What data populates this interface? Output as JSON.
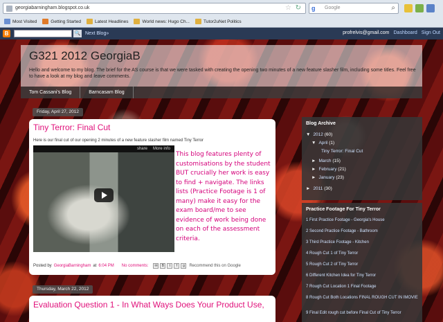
{
  "browser": {
    "url": "georgiabarningham.blogspot.co.uk",
    "search_placeholder": "Google",
    "bookmarks": [
      "Most Visited",
      "Getting Started",
      "Latest Headlines",
      "World news: Hugo Ch...",
      "Tutor2uNet Politics"
    ]
  },
  "navbar": {
    "next_blog": "Next Blog»",
    "email": "profrelvis@gmail.com",
    "dashboard": "Dashboard",
    "signout": "Sign Out"
  },
  "blog": {
    "title": "G321 2012 GeorgiaB",
    "description": "Hello and welcome to my blog. The brief for the AS course is that we were tasked with creating the opening two minutes of a new feature slasher film, including some titles. Feel free to have a look at my blog and leave comments.",
    "tabs": [
      "Tom Cassani's Blog",
      "Barncasam Blog"
    ]
  },
  "post1": {
    "date": "Friday, April 27, 2012",
    "title": "Tiny Terror: Final Cut",
    "intro": "Here is our final cut of our opening 2 minutes of a new feature slasher film named Tiny Terror",
    "video_share": "share",
    "video_info": "More info",
    "annotation": "This blog features plenty of customisations by the student BUT crucially her work is easy to find + navigate. The links lists (Practice Footage is 1 of many) make it easy for the exam board/me to see evidence of work being done on each of the assessment criteria.",
    "posted_by_prefix": "Posted by",
    "author": "GeorgiaBarningham",
    "at": "at",
    "time": "6:04 PM",
    "comments": "No comments:",
    "recommend": "Recommend this on Google"
  },
  "post2": {
    "date": "Thursday, March 22, 2012",
    "title": "Evaluation Question 1 - In What Ways Does Your Product Use,"
  },
  "archive": {
    "title": "Blog Archive",
    "y2012": "2012",
    "y2012_count": "(60)",
    "april": "April",
    "april_count": "(1)",
    "april_post": "Tiny Terror: Final Cut",
    "march": "March",
    "march_count": "(15)",
    "february": "February",
    "february_count": "(21)",
    "january": "January",
    "january_count": "(23)",
    "y2011": "2011",
    "y2011_count": "(30)"
  },
  "footage": {
    "title": "Practice Footage For Tiny Terror",
    "items": [
      "1 First Practice Footage - Georgia's House",
      "2 Second Practice Footage - Bathroom",
      "3 Third Practice Footage - Kitchen",
      "4 Rough Cut 1 of Tiny Terror",
      "5 Rough Cut 2 of Tiny Terror",
      "6 Different Kitchen Idea for Tiny Terror",
      "7 Rough Cut Location 1 Final Footage",
      "8 Rough Cut Both Locations FINAL ROUGH CUT IN IMOVIE",
      "9 Final Edit rough cut before Final Cut of Tiny Terror"
    ]
  }
}
